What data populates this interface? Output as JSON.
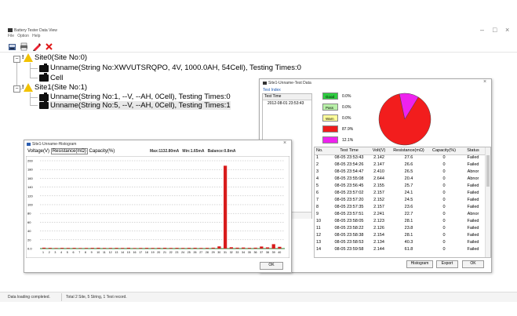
{
  "app": {
    "title": "Battery Tester Data View",
    "menu": [
      "File",
      "Option",
      "Help"
    ],
    "window_controls": {
      "minimize": "–",
      "maximize": "□",
      "close": "×"
    }
  },
  "tree": {
    "site0": {
      "label": "Site0(Site No:0)"
    },
    "site0_string": {
      "label": "Unname(String No:XWVUTSRQPO, 4V, 1000.0AH, 54Cell), Testing Times:0"
    },
    "site0_cell": {
      "label": "Cell"
    },
    "site1": {
      "label": "Site1(Site No:1)"
    },
    "site1_string1": {
      "label": "Unname(String No:1, --V, --AH, 0Cell), Testing Times:0"
    },
    "site1_string5": {
      "label": "Unname(String No:5, --V, --AH, 0Cell), Testing Times:1"
    }
  },
  "status": {
    "left": "Data loading completed.",
    "right": "Total 2 Site, 5 String, 1 Test record."
  },
  "test_data": {
    "title": "Site1-Unname-Test Data",
    "close": "×",
    "index_label": "Test Index",
    "index_header": "Test Time",
    "index_value": "2012-08-01 23:53:43",
    "legend": [
      {
        "label": "Good",
        "pct": "0.0%",
        "color": "#2ecc40"
      },
      {
        "label": "Pass",
        "pct": "0.0%",
        "color": "#b8f0a8"
      },
      {
        "label": "Warn",
        "pct": "0.0%",
        "color": "#ffff9a"
      },
      {
        "label": "Abnor",
        "pct": "87.9%",
        "color": "#ee1c1c"
      },
      {
        "label": "Failed",
        "pct": "12.1%",
        "color": "#ee22ee"
      }
    ],
    "pie_fractions": [
      {
        "value": 0.879,
        "color": "#f21d1d"
      },
      {
        "value": 0.121,
        "color": "#ee22ee"
      }
    ],
    "columns": [
      "No.",
      "Test Time",
      "Volt(V)",
      "Resistance(mΩ)",
      "Capacity(%)",
      "Status"
    ],
    "rows": [
      [
        "1",
        "08-05 23:53:43",
        "2.142",
        "27.6",
        "0",
        "Failed"
      ],
      [
        "2",
        "08-05 23:54:26",
        "2.147",
        "26.6",
        "0",
        "Failed"
      ],
      [
        "3",
        "08-05 23:54:47",
        "2.410",
        "26.5",
        "0",
        "Abnor"
      ],
      [
        "4",
        "08-05 23:55:08",
        "2.644",
        "20.4",
        "0",
        "Abnor"
      ],
      [
        "5",
        "08-05 23:56:45",
        "2.155",
        "25.7",
        "0",
        "Failed"
      ],
      [
        "6",
        "08-05 23:57:02",
        "2.157",
        "24.1",
        "0",
        "Failed"
      ],
      [
        "7",
        "08-05 23:57:20",
        "2.152",
        "24.5",
        "0",
        "Failed"
      ],
      [
        "8",
        "08-05 23:57:35",
        "2.157",
        "23.6",
        "0",
        "Failed"
      ],
      [
        "9",
        "08-05 23:57:51",
        "2.241",
        "22.7",
        "0",
        "Abnor"
      ],
      [
        "10",
        "08-05 23:58:05",
        "2.123",
        "28.1",
        "0",
        "Failed"
      ],
      [
        "11",
        "08-05 23:58:22",
        "2.126",
        "23.8",
        "0",
        "Failed"
      ],
      [
        "12",
        "08-05 23:58:38",
        "2.154",
        "28.1",
        "0",
        "Failed"
      ],
      [
        "13",
        "08-05 23:58:53",
        "2.134",
        "40.3",
        "0",
        "Failed"
      ],
      [
        "14",
        "08-05 23:59:58",
        "2.144",
        "61.8",
        "0",
        "Failed"
      ]
    ],
    "buttons": {
      "histogram": "Histogram",
      "export": "Export",
      "ok": "OK"
    }
  },
  "histogram": {
    "title": "Site1-Unname-Histogram",
    "tabs": [
      "Voltage(V)",
      "Resistance(mΩ)",
      "Capacity(%)"
    ],
    "stats": [
      "Max:1132.80mA",
      "Min:1.65mA",
      "Balance:0.8mA"
    ],
    "ok": "OK",
    "chart_data": {
      "type": "bar",
      "categories": [
        "1",
        "2",
        "3",
        "4",
        "5",
        "6",
        "7",
        "8",
        "9",
        "10",
        "11",
        "12",
        "13",
        "14",
        "15",
        "16",
        "17",
        "18",
        "19",
        "20",
        "21",
        "22",
        "23",
        "24",
        "25",
        "26",
        "27",
        "28",
        "29",
        "30",
        "31",
        "32",
        "33",
        "34",
        "35",
        "36",
        "37",
        "38",
        "39",
        "40"
      ],
      "values": [
        12,
        10,
        8,
        10,
        9,
        10,
        8,
        9,
        10,
        11,
        9,
        9,
        10,
        9,
        11,
        8,
        9,
        10,
        9,
        10,
        11,
        9,
        10,
        9,
        10,
        11,
        9,
        10,
        12,
        30,
        1132,
        18,
        12,
        14,
        10,
        12,
        28,
        16,
        60,
        24
      ],
      "yticks": [
        "200",
        "180",
        "160",
        "140",
        "120",
        "100",
        "80",
        "60",
        "40",
        "20",
        "0.0"
      ],
      "ylim": [
        0,
        1200
      ],
      "color": "#d81c1c"
    }
  }
}
